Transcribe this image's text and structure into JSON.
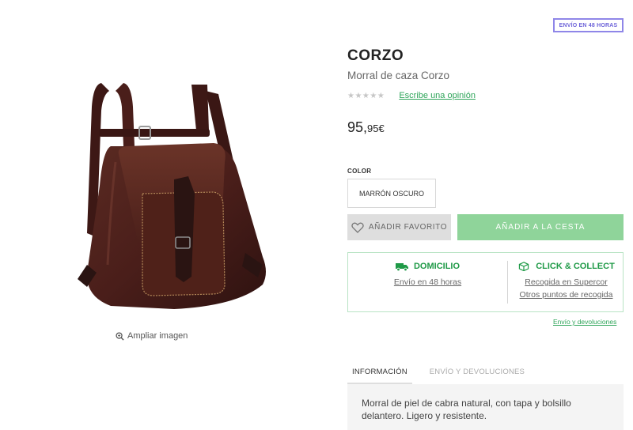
{
  "badge": "ENVÍO EN 48 HORAS",
  "product": {
    "brand": "CORZO",
    "subtitle": "Morral de caza Corzo",
    "stars": "★★★★★",
    "review_link": "Escribe una opinión",
    "price_whole": "95,",
    "price_cents": "95€",
    "zoom_label": "Ampliar imagen"
  },
  "color": {
    "label": "COLOR",
    "selected": "MARRÓN OSCURO"
  },
  "actions": {
    "favorite": "AÑADIR FAVORITO",
    "cart": "AÑADIR A LA CESTA"
  },
  "delivery": {
    "home_title": "DOMICILIO",
    "home_link": "Envío en 48 horas",
    "collect_title": "CLICK & COLLECT",
    "collect_link_1": "Recogida en Supercor",
    "collect_link_2": "Otros puntos de recogida"
  },
  "returns_link": "Envío y devoluciones",
  "tabs": [
    {
      "label": "INFORMACIÓN",
      "active": true
    },
    {
      "label": "ENVÍO Y DEVOLUCIONES",
      "active": false
    }
  ],
  "info_text": "Morral de piel de cabra natural, con tapa y bolsillo delantero. Ligero y resistente.",
  "colors": {
    "accent_green": "#1f9a47",
    "cart_button": "#8fd49a",
    "badge_border": "#8f86e8"
  }
}
